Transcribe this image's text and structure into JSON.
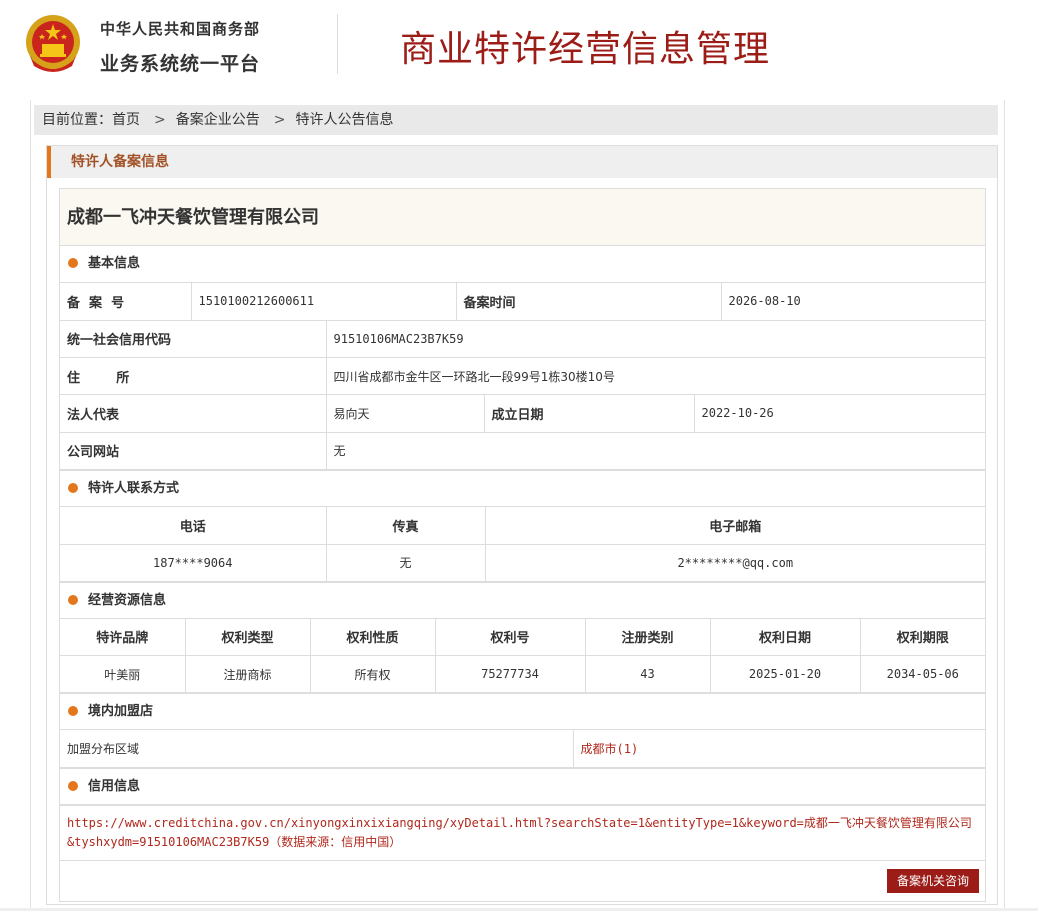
{
  "header": {
    "org_line1": "中华人民共和国商务部",
    "org_line2": "业务系统统一平台",
    "page_title": "商业特许经营信息管理"
  },
  "breadcrumb": {
    "prefix": "目前位置：",
    "items": [
      "首页",
      "备案企业公告",
      "特许人公告信息"
    ],
    "separator": ">"
  },
  "panel": {
    "title": "特许人备案信息",
    "company_name": "成都一飞冲天餐饮管理有限公司"
  },
  "basic": {
    "section_title": "基本信息",
    "record_no_label": "备  案  号",
    "record_no": "1510100212600611",
    "record_time_label": "备案时间",
    "record_time": "2026-08-10",
    "credit_code_label": "统一社会信用代码",
    "credit_code": "91510106MAC23B7K59",
    "address_label": "住        所",
    "address": "四川省成都市金牛区一环路北一段99号1栋30楼10号",
    "legal_rep_label": "法人代表",
    "legal_rep": "易向天",
    "established_label": "成立日期",
    "established": "2022-10-26",
    "website_label": "公司网站",
    "website": "无"
  },
  "contact": {
    "section_title": "特许人联系方式",
    "headers": [
      "电话",
      "传真",
      "电子邮箱"
    ],
    "phone": "187****9064",
    "fax": "无",
    "email": "2********@qq.com"
  },
  "resources": {
    "section_title": "经营资源信息",
    "headers": [
      "特许品牌",
      "权利类型",
      "权利性质",
      "权利号",
      "注册类别",
      "权利日期",
      "权利期限"
    ],
    "row": [
      "叶美丽",
      "注册商标",
      "所有权",
      "75277734",
      "43",
      "2025-01-20",
      "2034-05-06"
    ]
  },
  "stores": {
    "section_title": "境内加盟店",
    "region_label": "加盟分布区域",
    "region_value": "成都市(1)"
  },
  "credit": {
    "section_title": "信用信息",
    "url_text": "https://www.creditchina.gov.cn/xinyongxinxixiangqing/xyDetail.html?searchState=1&entityType=1&keyword=成都一飞冲天餐饮管理有限公司&tyshxydm=91510106MAC23B7K59（数据来源：信用中国）"
  },
  "actions": {
    "query_button": "备案机关咨询"
  },
  "colors": {
    "brand_red": "#9c1c17",
    "accent_orange": "#e4761c",
    "link_red": "#b0281c"
  }
}
